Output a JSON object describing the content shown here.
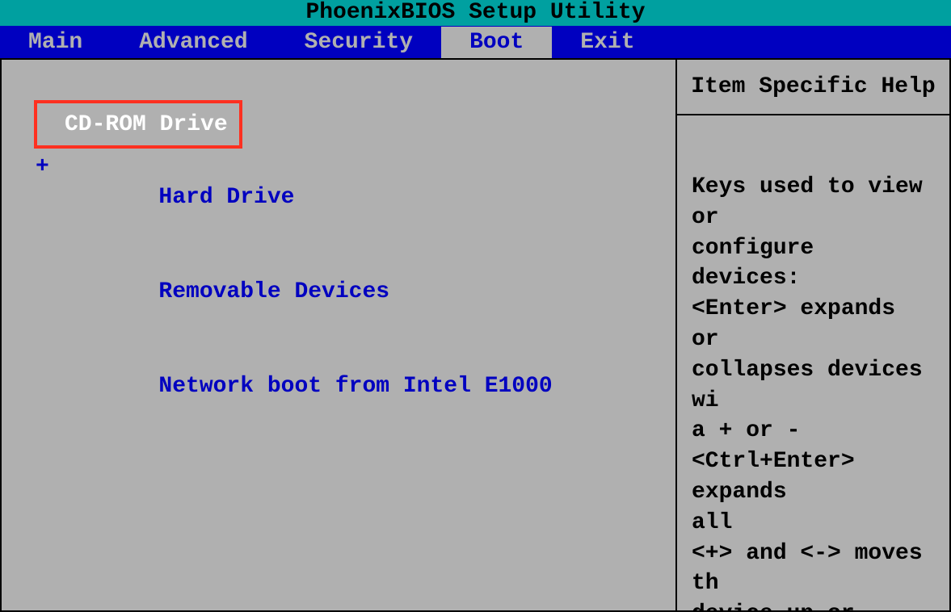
{
  "title": "PhoenixBIOS Setup Utility",
  "menu": {
    "items": [
      "Main",
      "Advanced",
      "Security",
      "Boot",
      "Exit"
    ],
    "active_index": 3
  },
  "boot": {
    "selected_index": 0,
    "items": [
      {
        "label": "CD-ROM Drive",
        "expandable": false
      },
      {
        "label": "Hard Drive",
        "expandable": true
      },
      {
        "label": "Removable Devices",
        "expandable": false
      },
      {
        "label": "Network boot from Intel E1000",
        "expandable": false
      }
    ]
  },
  "help": {
    "title": "Item Specific Help",
    "body": "Keys used to view or\nconfigure devices:\n<Enter> expands or\ncollapses devices wi\na + or -\n<Ctrl+Enter> expands\nall\n<+> and <-> moves th\ndevice up or down.\n<n> May move removab\ndevice between Hard\nDisk or Removable Di\n<d> Remove a device\nthat is not installe"
  }
}
